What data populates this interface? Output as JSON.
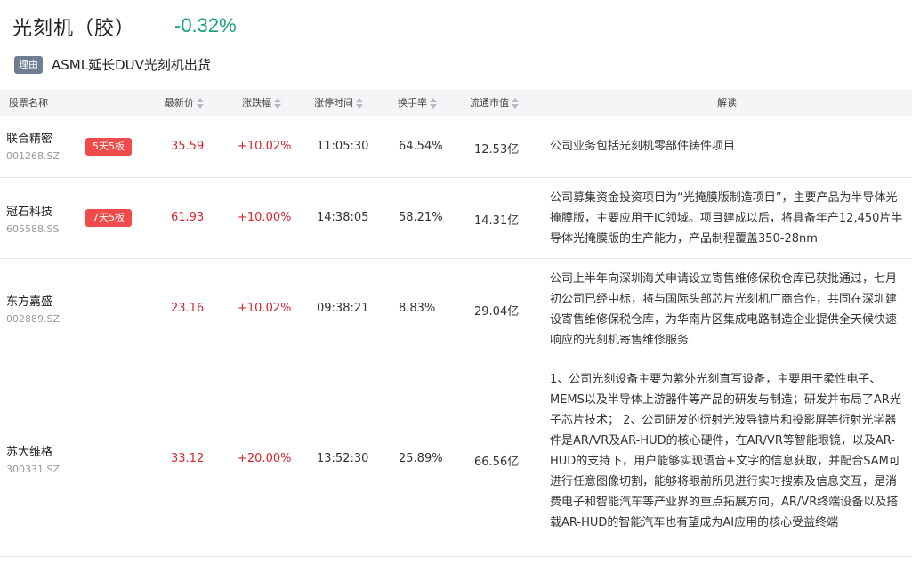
{
  "header": {
    "title": "光刻机（胶）",
    "change": "-0.32%",
    "reason_tag": "理由",
    "reason_text": "ASML延长DUV光刻机出货"
  },
  "table": {
    "columns": {
      "name": "股票名称",
      "price": "最新价",
      "pct": "涨跌幅",
      "limit_time": "涨停时间",
      "turnover": "换手率",
      "cap": "流通市值",
      "desc": "解读"
    },
    "rows": [
      {
        "name": "联合精密",
        "code": "001268.SZ",
        "badge": "5天5板",
        "price": "35.59",
        "pct": "+10.02%",
        "limit_time": "11:05:30",
        "turnover": "64.54%",
        "cap": "12.53亿",
        "desc": "公司业务包括光刻机零部件铸件项目"
      },
      {
        "name": "冠石科技",
        "code": "605588.SS",
        "badge": "7天5板",
        "price": "61.93",
        "pct": "+10.00%",
        "limit_time": "14:38:05",
        "turnover": "58.21%",
        "cap": "14.31亿",
        "desc": "公司募集资金投资项目为“光掩膜版制造项目”，主要产品为半导体光掩膜版，主要应用于IC领域。项目建成以后，将具备年产12,450片半导体光掩膜版的生产能力，产品制程覆盖350-28nm"
      },
      {
        "name": "东方嘉盛",
        "code": "002889.SZ",
        "badge": "",
        "price": "23.16",
        "pct": "+10.02%",
        "limit_time": "09:38:21",
        "turnover": "8.83%",
        "cap": "29.04亿",
        "desc": "公司上半年向深圳海关申请设立寄售维修保税仓库已获批通过，七月初公司已经中标，将与国际头部芯片光刻机厂商合作，共同在深圳建设寄售维修保税仓库，为华南片区集成电路制造企业提供全天候快速响应的光刻机寄售维修服务"
      },
      {
        "name": "苏大维格",
        "code": "300331.SZ",
        "badge": "",
        "price": "33.12",
        "pct": "+20.00%",
        "limit_time": "13:52:30",
        "turnover": "25.89%",
        "cap": "66.56亿",
        "desc": "1、公司光刻设备主要为紫外光刻直写设备，主要用于柔性电子、MEMS以及半导体上游器件等产品的研发与制造；研发并布局了AR光子芯片技术； 2、公司研发的衍射光波导镜片和投影屏等衍射光学器件是AR/VR及AR-HUD的核心硬件，在AR/VR等智能眼镜，以及AR-HUD的支持下，用户能够实现语音+文字的信息获取，并配合SAM可进行任意图像切割，能够将眼前所见进行实时搜索及信息交互，是消费电子和智能汽车等产业界的重点拓展方向，AR/VR终端设备以及搭载AR-HUD的智能汽车也有望成为AI应用的核心受益终端"
      }
    ]
  }
}
